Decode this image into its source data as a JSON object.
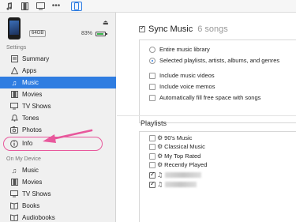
{
  "toolbar": {
    "icons": [
      "music-note-icon",
      "film-icon",
      "tv-icon",
      "more-icon",
      "device-icon"
    ],
    "more_label": "•••"
  },
  "device": {
    "capacity": "64GB",
    "battery_text": "83%",
    "battery_level": 0.83,
    "battery_color": "#36b24a"
  },
  "sidebar": {
    "settings_header": "Settings",
    "settings_items": [
      {
        "label": "Summary",
        "icon": "summary-icon",
        "active": false
      },
      {
        "label": "Apps",
        "icon": "apps-icon",
        "active": false
      },
      {
        "label": "Music",
        "icon": "music-icon",
        "active": true
      },
      {
        "label": "Movies",
        "icon": "movies-icon",
        "active": false
      },
      {
        "label": "TV Shows",
        "icon": "tv-shows-icon",
        "active": false
      },
      {
        "label": "Tones",
        "icon": "bell-icon",
        "active": false
      },
      {
        "label": "Photos",
        "icon": "photos-icon",
        "active": false
      },
      {
        "label": "Info",
        "icon": "info-icon",
        "active": false
      }
    ],
    "on_device_header": "On My Device",
    "device_items": [
      {
        "label": "Music",
        "icon": "music-icon"
      },
      {
        "label": "Movies",
        "icon": "movies-icon"
      },
      {
        "label": "TV Shows",
        "icon": "tv-shows-icon"
      },
      {
        "label": "Books",
        "icon": "books-icon"
      },
      {
        "label": "Audiobooks",
        "icon": "audiobooks-icon"
      }
    ]
  },
  "main": {
    "sync_label": "Sync Music",
    "sync_count": "6 songs",
    "sync_checked": true,
    "options": [
      {
        "type": "radio",
        "label": "Entire music library",
        "selected": false
      },
      {
        "type": "radio",
        "label": "Selected playlists, artists, albums, and genres",
        "selected": true
      },
      {
        "type": "checkbox",
        "label": "Include music videos",
        "checked": false
      },
      {
        "type": "checkbox",
        "label": "Include voice memos",
        "checked": false
      },
      {
        "type": "checkbox",
        "label": "Automatically fill free space with songs",
        "checked": false
      }
    ],
    "playlists_title": "Playlists",
    "playlists": [
      {
        "label": "90's Music",
        "checked": false,
        "icon": "gear-icon"
      },
      {
        "label": "Classical Music",
        "checked": false,
        "icon": "gear-icon"
      },
      {
        "label": "My Top Rated",
        "checked": false,
        "icon": "gear-icon"
      },
      {
        "label": "Recently Played",
        "checked": false,
        "icon": "gear-icon"
      },
      {
        "label": "",
        "checked": true,
        "icon": "playlist-icon"
      },
      {
        "label": "",
        "checked": true,
        "icon": "playlist-icon"
      }
    ]
  },
  "colors": {
    "accent": "#2f7de1",
    "highlight": "#e8589c"
  }
}
